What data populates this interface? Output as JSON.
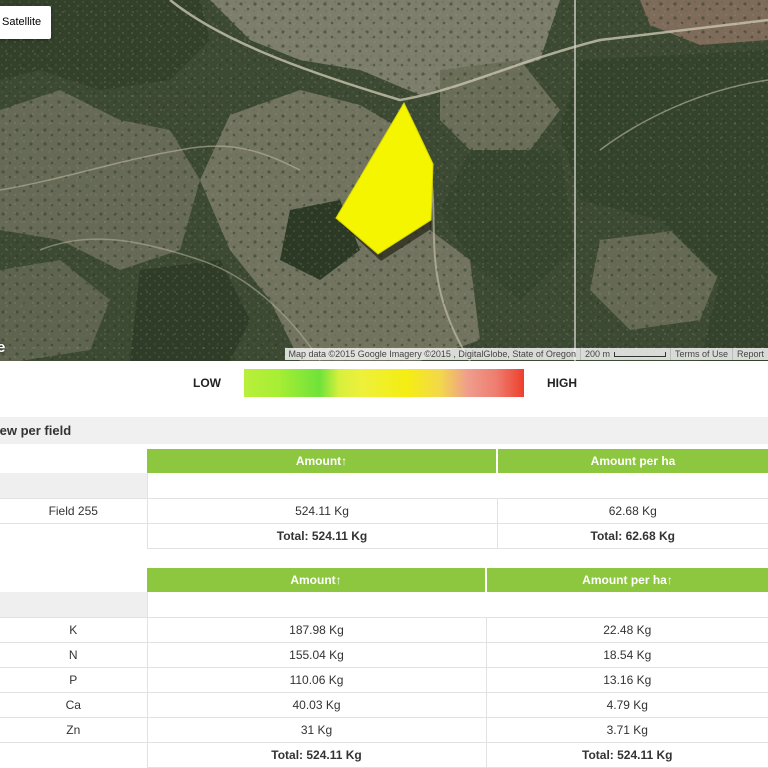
{
  "map": {
    "type_button": "Satellite",
    "logo_fragment": "e",
    "attribution": {
      "map_data": "Map data ©2015 Google Imagery ©2015 , DigitalGlobe, State of Oregon",
      "scale_label": "200 m",
      "terms": "Terms of Use",
      "report": "Report"
    },
    "field_polygon_color": "#f5f500"
  },
  "legend": {
    "low": "LOW",
    "high": "HIGH"
  },
  "overview": {
    "title": "iew per field"
  },
  "field_table": {
    "headers": [
      "Amount↑",
      "Amount per ha"
    ],
    "rows": [
      {
        "name": "Field 255",
        "amount": "524.11 Kg",
        "per_ha": "62.68 Kg"
      }
    ],
    "total_amount": "Total: 524.11 Kg",
    "total_per_ha": "Total: 62.68 Kg"
  },
  "nutrient_table": {
    "headers": [
      "Amount↑",
      "Amount per ha↑"
    ],
    "rows": [
      {
        "name": "K",
        "amount": "187.98 Kg",
        "per_ha": "22.48 Kg"
      },
      {
        "name": "N",
        "amount": "155.04 Kg",
        "per_ha": "18.54 Kg"
      },
      {
        "name": "P",
        "amount": "110.06 Kg",
        "per_ha": "13.16 Kg"
      },
      {
        "name": "Ca",
        "amount": "40.03 Kg",
        "per_ha": "4.79 Kg"
      },
      {
        "name": "Zn",
        "amount": "31 Kg",
        "per_ha": "3.71 Kg"
      }
    ],
    "total_amount": "Total: 524.11 Kg",
    "total_per_ha": "Total: 524.11 Kg"
  }
}
